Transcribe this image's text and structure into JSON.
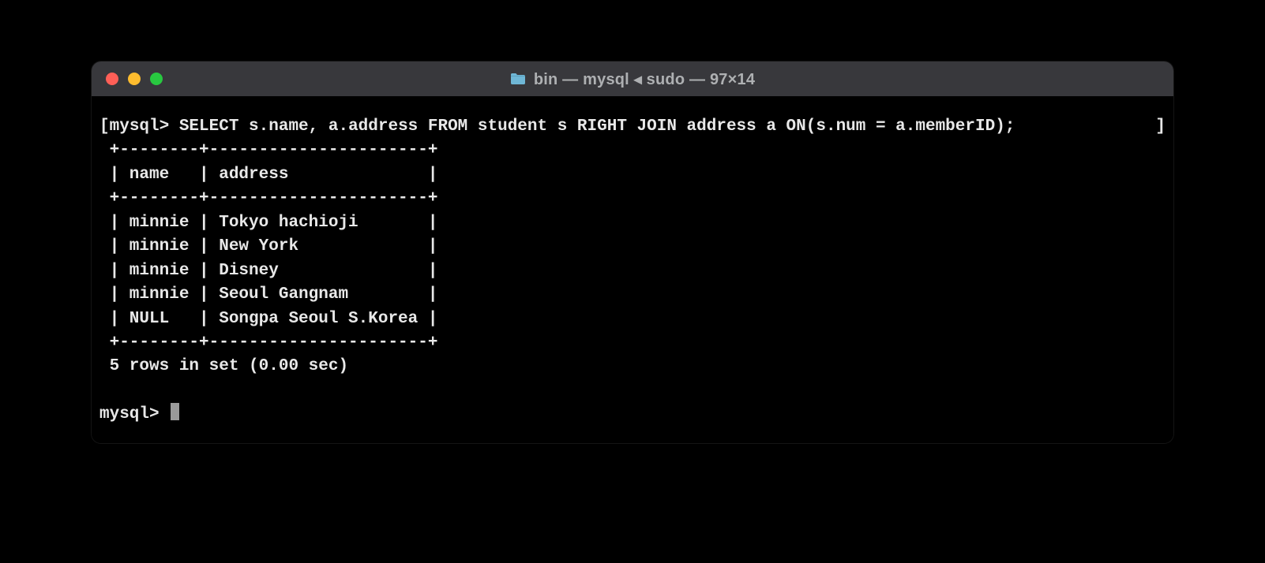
{
  "window": {
    "title": "bin — mysql ◂ sudo — 97×14"
  },
  "terminal": {
    "open_bracket": "[",
    "close_bracket": "]",
    "prompt_symbol": "mysql> ",
    "query": "SELECT s.name, a.address FROM student s RIGHT JOIN address a ON(s.num = a.memberID);",
    "table_lines": {
      "border": "+--------+----------------------+",
      "header": "| name   | address              |",
      "rows": [
        "| minnie | Tokyo hachioji       |",
        "| minnie | New York             |",
        "| minnie | Disney               |",
        "| minnie | Seoul Gangnam        |",
        "| NULL   | Songpa Seoul S.Korea |"
      ]
    },
    "summary": "5 rows in set (0.00 sec)",
    "blank": ""
  },
  "chart_data": {
    "type": "table",
    "title": "SELECT s.name, a.address FROM student s RIGHT JOIN address a ON(s.num = a.memberID);",
    "columns": [
      "name",
      "address"
    ],
    "rows": [
      [
        "minnie",
        "Tokyo hachioji"
      ],
      [
        "minnie",
        "New York"
      ],
      [
        "minnie",
        "Disney"
      ],
      [
        "minnie",
        "Seoul Gangnam"
      ],
      [
        "NULL",
        "Songpa Seoul S.Korea"
      ]
    ],
    "row_count": 5,
    "elapsed_sec": 0.0
  }
}
